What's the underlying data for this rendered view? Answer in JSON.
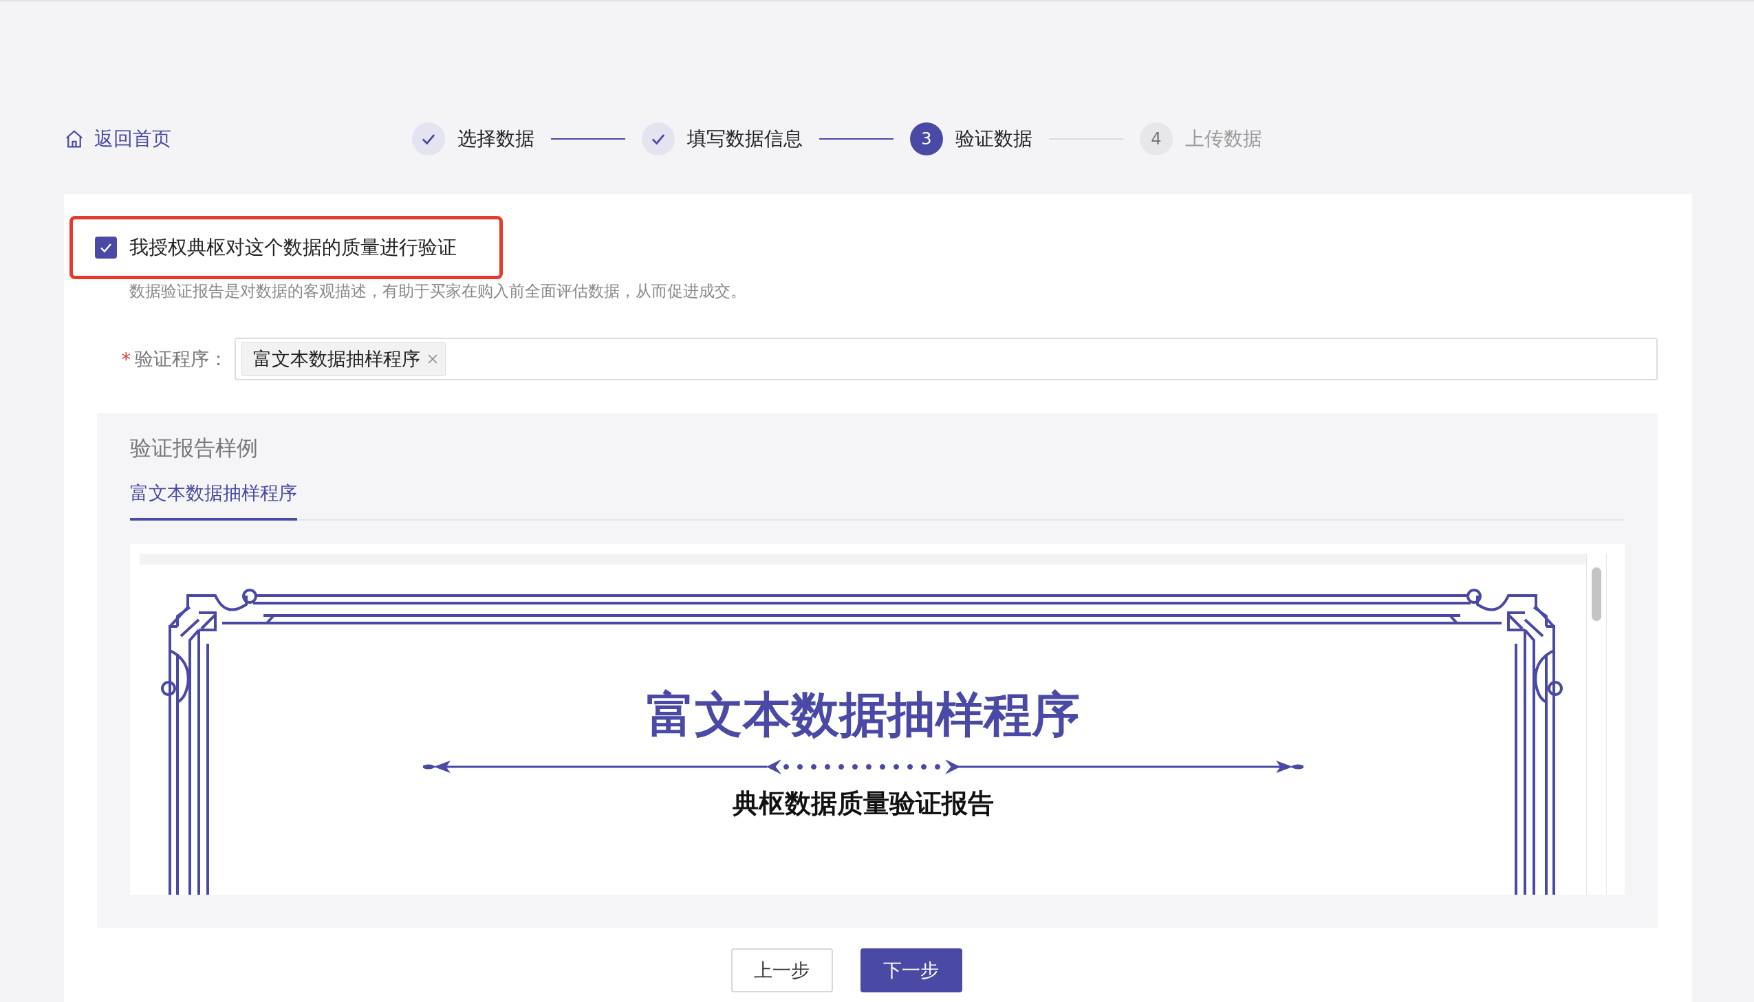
{
  "back_link": "返回首页",
  "steps": [
    {
      "label": "选择数据",
      "completed": true,
      "selected": false
    },
    {
      "label": "填写数据信息",
      "completed": true,
      "selected": false
    },
    {
      "label": "验证数据",
      "completed": false,
      "selected": true,
      "number": "3"
    },
    {
      "label": "上传数据",
      "completed": false,
      "selected": false,
      "number": "4"
    }
  ],
  "authorization": {
    "checked": true,
    "label": "我授权典枢对这个数据的质量进行验证",
    "hint": "数据验证报告是对数据的客观描述，有助于买家在购入前全面评估数据，从而促进成交。"
  },
  "program_field": {
    "required_mark": "*",
    "label": "验证程序：",
    "tags": [
      {
        "label": "富文本数据抽样程序"
      }
    ]
  },
  "sample": {
    "title": "验证报告样例",
    "tabs": [
      {
        "label": "富文本数据抽样程序",
        "selected": true
      }
    ],
    "report": {
      "title": "富文本数据抽样程序",
      "subtitle": "典枢数据质量验证报告"
    }
  },
  "buttons": [
    {
      "label": "上一步",
      "kind": "secondary"
    },
    {
      "label": "下一步",
      "kind": "primary"
    }
  ]
}
